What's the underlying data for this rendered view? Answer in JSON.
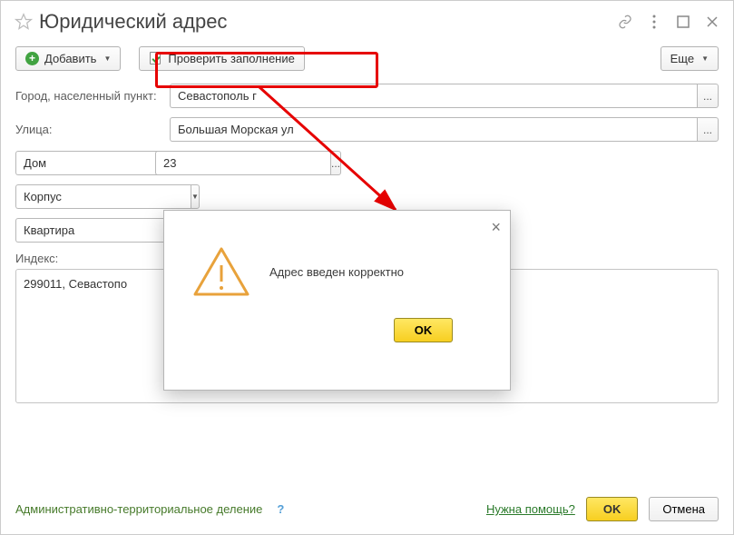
{
  "title": "Юридический адрес",
  "toolbar": {
    "add_label": "Добавить",
    "verify_label": "Проверить заполнение",
    "more_label": "Еще"
  },
  "form": {
    "city_label": "Город, населенный пункт:",
    "city_value": "Севастополь г",
    "street_label": "Улица:",
    "street_value": "Большая Морская ул",
    "house_label": "Дом",
    "house_value": "23",
    "corpus_label": "Корпус",
    "corpus_value": "",
    "apartment_label": "Квартира",
    "apartment_value": "",
    "index_label": "Индекс:",
    "summary_value": "299011, Севастопо"
  },
  "footer": {
    "admin_link": "Административно-территориальное деление",
    "help_link": "Нужна помощь?",
    "ok_label": "OK",
    "cancel_label": "Отмена"
  },
  "dialog": {
    "message": "Адрес введен корректно",
    "ok_label": "OK"
  }
}
